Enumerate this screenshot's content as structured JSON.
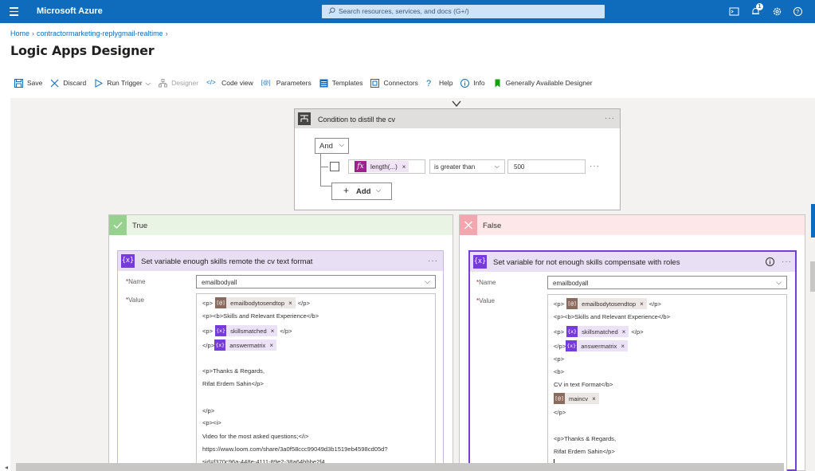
{
  "topbar": {
    "brand": "Microsoft Azure",
    "search_placeholder": "Search resources, services, and docs (G+/)",
    "notification_count": "1"
  },
  "breadcrumb": {
    "home": "Home",
    "resource": "contractormarketing-replygmail-realtime"
  },
  "page": {
    "title": "Logic Apps Designer",
    "more": "···"
  },
  "toolbar": {
    "save": "Save",
    "discard": "Discard",
    "run_trigger": "Run Trigger",
    "designer": "Designer",
    "code_view": "Code view",
    "parameters": "Parameters",
    "templates": "Templates",
    "connectors": "Connectors",
    "help": "Help",
    "info": "Info",
    "ga_designer": "Generally Available Designer"
  },
  "condition": {
    "title": "Condition to distill the cv",
    "and_label": "And",
    "fx_label": "fx",
    "token": "length(...)",
    "operator": "is greater than",
    "value": "500",
    "add_label": "Add",
    "more": "···"
  },
  "true_branch": {
    "label": "True",
    "action": {
      "icon_text": "{x}",
      "title": "Set variable enough skills remote the cv text format",
      "name_label": "Name",
      "name_value": "emailbodyall",
      "value_label": "Value",
      "more": "···",
      "lines": {
        "l1_pre": "<p>",
        "l1_token": "emailbodytosendtop",
        "l1_post": "</p>",
        "l2": "<p><b>Skills and Relevant Experience</b>",
        "l3_pre": "<p>",
        "l3_token": "skillsmatched",
        "l3_post": "</p>",
        "l4_pre": "</p>",
        "l4_token": "answermatrix",
        "l6": "<p>Thanks & Regards,",
        "l7": "Rifat Erdem Sahin</p>",
        "l9": "</p>",
        "l10": "<p><i>",
        "l11": "Video for the most asked questions;</i>",
        "l12": "https://www.loom.com/share/3a0f58ccc99049d3b1519eb4598cd05d?",
        "l13": "sid=f370c96a-448e-4111-89e2-38a64bbbe2f4"
      }
    }
  },
  "false_branch": {
    "label": "False",
    "action": {
      "icon_text": "{x}",
      "title": "Set variable for not enough skills compensate with roles",
      "name_label": "Name",
      "name_value": "emailbodyall",
      "value_label": "Value",
      "more": "···",
      "lines": {
        "l1_pre": "<p>",
        "l1_token": "emailbodytosendtop",
        "l1_post": "</p>",
        "l2": "<p><b>Skills and Relevant Experience</b>",
        "l3_pre": "<p>",
        "l3_token": "skillsmatched",
        "l3_post": "</p>",
        "l4_pre": "</p>",
        "l4_token": "answermatrix",
        "l5": "<p>",
        "l6": "<b>",
        "l7": "CV in text Format</b>",
        "l8_token": "maincv",
        "l9": "</p>",
        "l11": "<p>Thanks & Regards,",
        "l12": "Rifat Erdem Sahin</p>"
      }
    }
  },
  "token_icons": {
    "var_icon": "{x}",
    "param_icon": "[@]"
  },
  "token_remove": "×",
  "colors": {
    "azure_blue": "#0f6cbd",
    "variable_purple": "#773adc",
    "true_green": "#96d28e",
    "false_red": "#f1a7ad"
  }
}
